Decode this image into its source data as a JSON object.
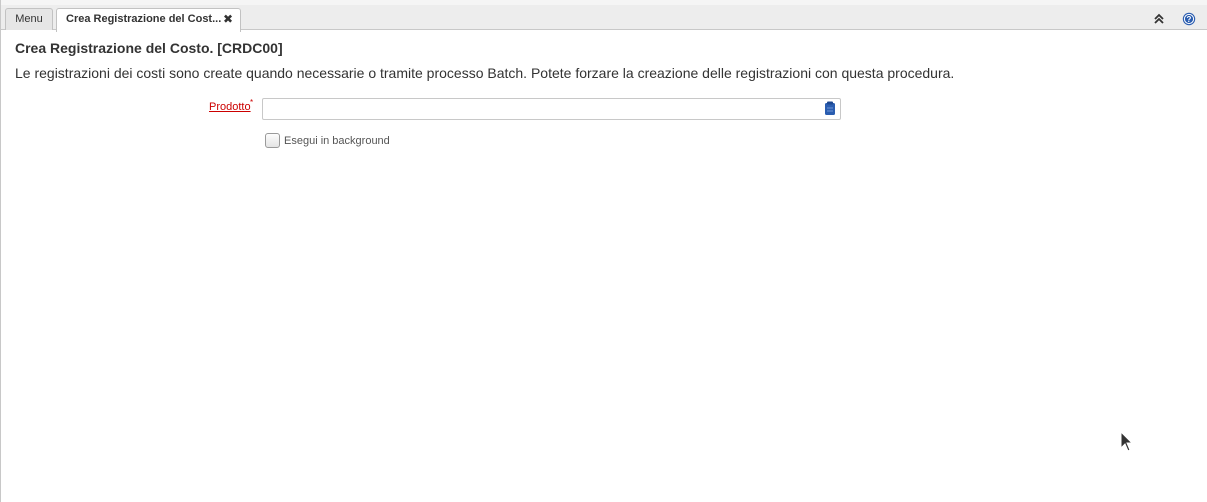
{
  "tabs": [
    {
      "label": "Menu",
      "active": false
    },
    {
      "label": "Crea Registrazione del Cost...",
      "active": true,
      "close_glyph": "✖"
    }
  ],
  "toolbar": {
    "collapse_icon": "double-chevron-up-icon",
    "help_icon": "help-icon"
  },
  "page": {
    "title": "Crea Registrazione del Costo. [CRDC00]",
    "description": "Le registrazioni dei costi sono create quando necessarie o tramite processo Batch. Potete forzare la creazione delle registrazioni con questa procedura."
  },
  "form": {
    "product": {
      "label": "Prodotto",
      "required_marker": "*",
      "value": "",
      "placeholder": "",
      "lookup_icon": "lookup-icon"
    },
    "background": {
      "label": "Esegui in background",
      "checked": false
    }
  },
  "colors": {
    "required_label": "#cc0000",
    "accent_blue": "#2a5db0"
  }
}
